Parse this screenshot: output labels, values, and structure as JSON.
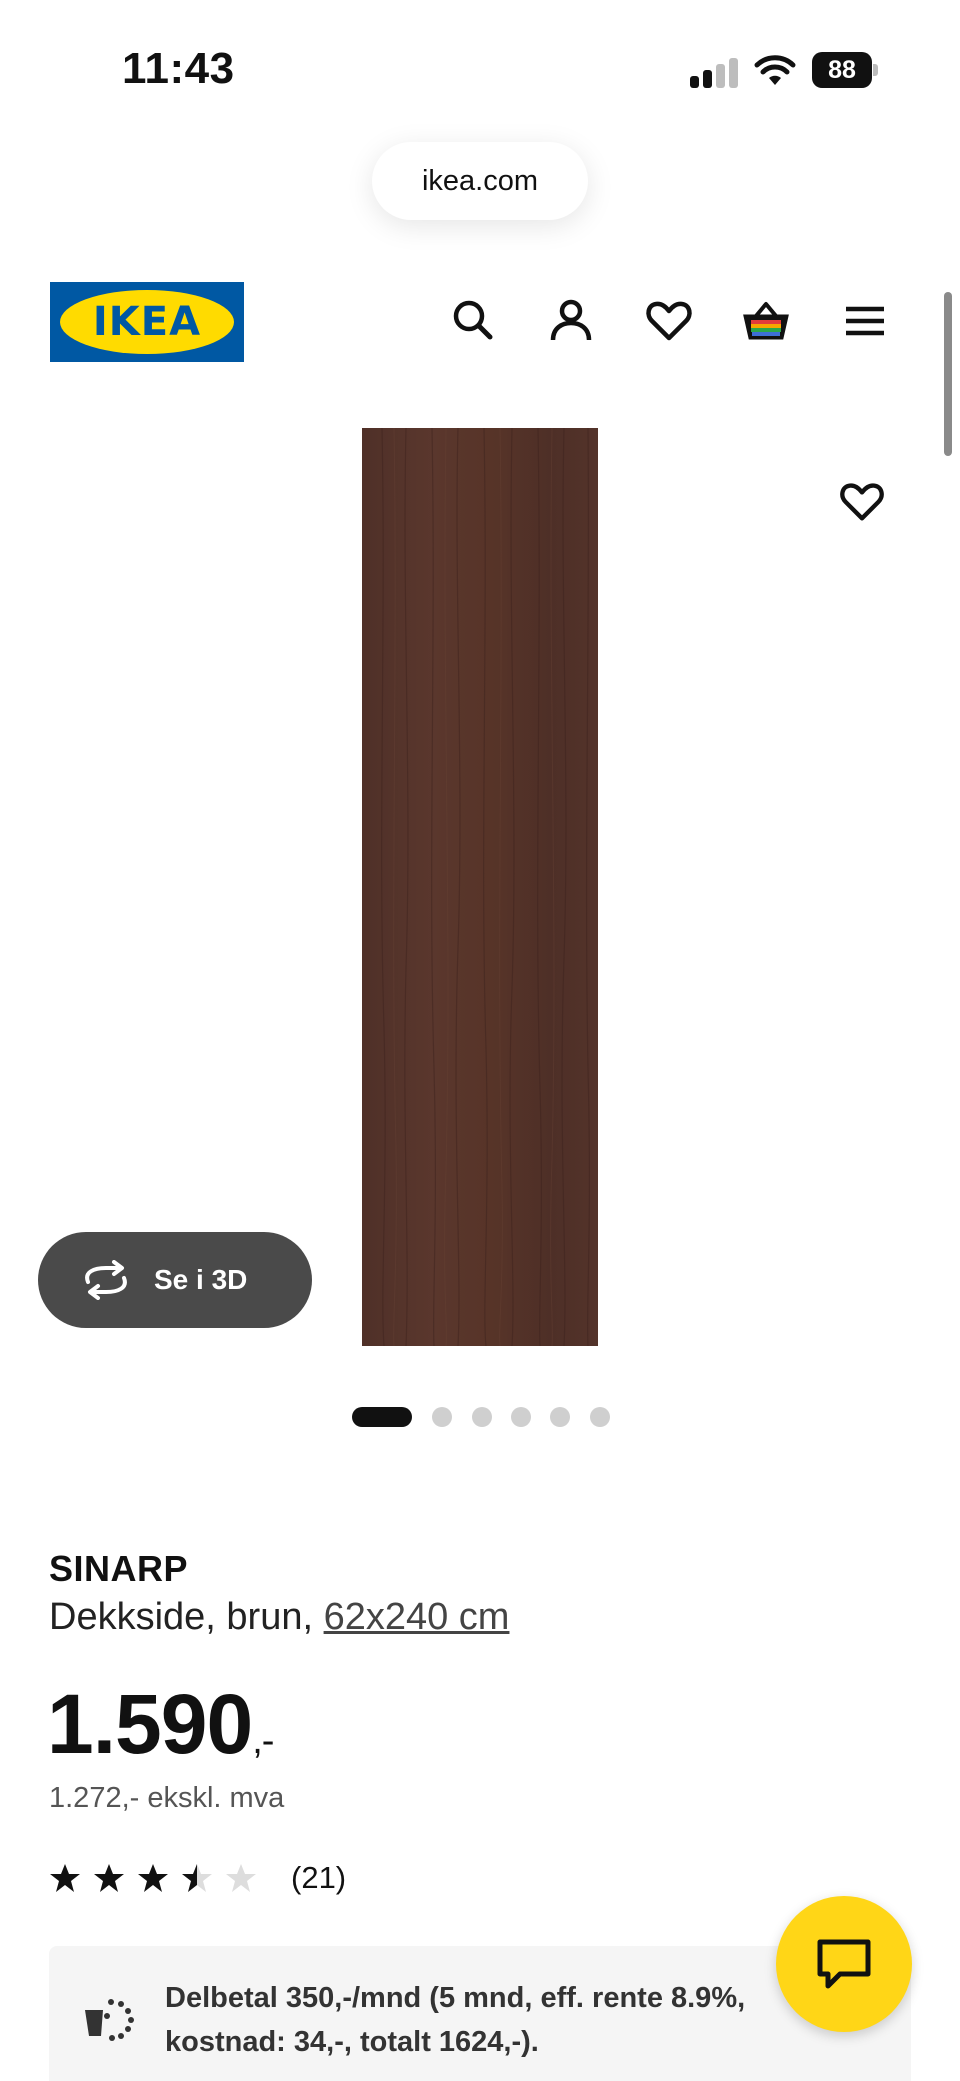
{
  "status_bar": {
    "time": "11:43",
    "battery": "88",
    "icons": [
      "signal-icon",
      "wifi-icon",
      "battery-icon"
    ]
  },
  "browser": {
    "url": "ikea.com"
  },
  "header": {
    "logo_text": "IKEA",
    "icons": [
      "search-icon",
      "account-icon",
      "heart-icon",
      "basket-icon",
      "menu-icon"
    ]
  },
  "gallery": {
    "view_3d_label": "Se i 3D",
    "image_count": 6,
    "active_index": 0
  },
  "product": {
    "name": "SINARP",
    "description": "Dekkside, brun, ",
    "size": "62x240 cm",
    "price": "1.590",
    "price_suffix": ",-",
    "price_ex_vat": "1.272,- ekskl. mva",
    "rating": 3.5,
    "rating_max": 5,
    "review_count": "(21)"
  },
  "financing": {
    "text": "Delbetal 350,-/mnd (5 mnd, eff. rente 8.9%, kostnad: 34,-, totalt 1624,-)."
  },
  "colors": {
    "ikea_blue": "#0058a3",
    "ikea_yellow": "#ffdb00",
    "chat_yellow": "#ffd617",
    "panel_brown": "#54342a"
  }
}
